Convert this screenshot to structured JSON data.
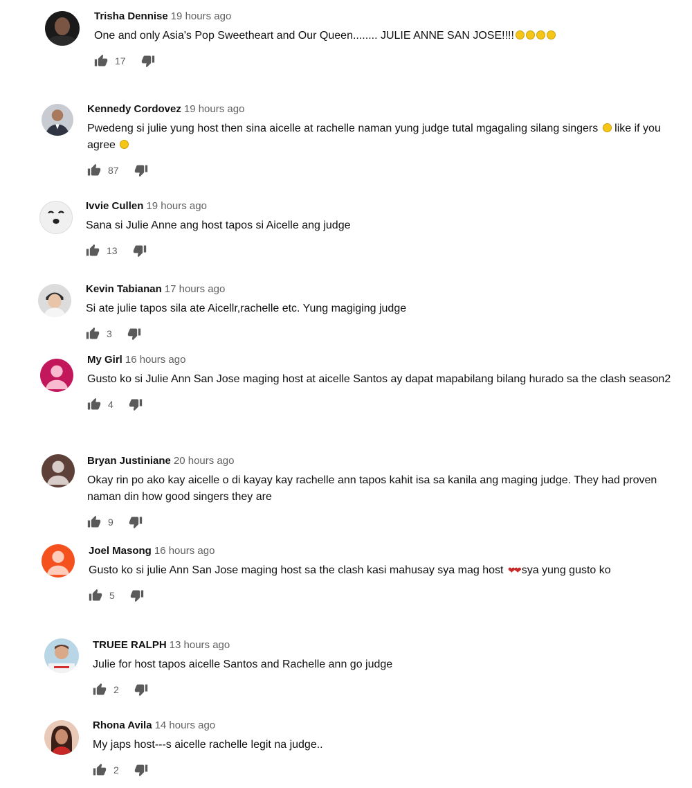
{
  "comments": [
    {
      "author": "Trisha Dennise",
      "time": "19 hours ago",
      "text": "One and only Asia's Pop Sweetheart and Our Queen........ JULIE ANNE SAN JOSE!!!!",
      "emoji_after": 4,
      "likes": "17",
      "avatar": {
        "type": "photo",
        "bg": "#1a1a1a",
        "fg": "#6b4b3e"
      }
    },
    {
      "author": "Kennedy Cordovez",
      "time": "19 hours ago",
      "text": "Pwedeng si julie yung host then sina aicelle at rachelle naman yung judge tutal mgagaling silang singers",
      "text_tail": " like if you agree",
      "likes": "87",
      "avatar": {
        "type": "photo",
        "bg": "#c8ccd2",
        "fg": "#3a3f4a"
      }
    },
    {
      "author": "Ivvie Cullen",
      "time": "19 hours ago",
      "text": "Sana si Julie Anne ang host tapos si Aicelle ang judge",
      "likes": "13",
      "avatar": {
        "type": "face",
        "bg": "#f0f0f0",
        "fg": "#222222"
      }
    },
    {
      "author": "Kevin Tabianan",
      "time": "17 hours ago",
      "text": "Si ate julie tapos sila ate Aicellr,rachelle etc. Yung magiging judge",
      "likes": "3",
      "avatar": {
        "type": "photo",
        "bg": "#dcdcdc",
        "fg": "#2b2b2b"
      }
    },
    {
      "author": "My Girl",
      "time": "16 hours ago",
      "text": "Gusto ko si Julie Ann San Jose maging host at aicelle Santos ay dapat mapabilang bilang hurado sa the clash season2",
      "likes": "4",
      "avatar": {
        "type": "default",
        "bg": "#c2185b",
        "fg": "#f8bbd0"
      }
    },
    {
      "author": "Bryan Justiniane",
      "time": "20 hours ago",
      "text": "Okay rin po ako kay aicelle o di kayay kay rachelle ann tapos kahit isa sa kanila ang maging judge. They had proven naman din how good singers they are",
      "likes": "9",
      "avatar": {
        "type": "default",
        "bg": "#5d4037",
        "fg": "#d7ccc8"
      }
    },
    {
      "author": "Joel Masong",
      "time": "16 hours ago",
      "text": "Gusto ko si julie Ann San Jose maging host sa the clash kasi mahusay sya mag host",
      "text_tail": "sya yung gusto ko",
      "hearts": true,
      "likes": "5",
      "avatar": {
        "type": "default",
        "bg": "#f4511e",
        "fg": "#ffccbc"
      }
    },
    {
      "author": "TRUEE RALPH",
      "time": "13 hours ago",
      "text": "Julie for host tapos aicelle Santos and Rachelle ann go judge",
      "likes": "2",
      "avatar": {
        "type": "photo",
        "bg": "#b9d6e6",
        "fg": "#8a5a44"
      }
    },
    {
      "author": "Rhona Avila",
      "time": "14 hours ago",
      "text": "My japs host---s aicelle rachelle legit na judge..",
      "likes": "2",
      "avatar": {
        "type": "photo",
        "bg": "#e9c9b8",
        "fg": "#4a2a22"
      }
    }
  ]
}
